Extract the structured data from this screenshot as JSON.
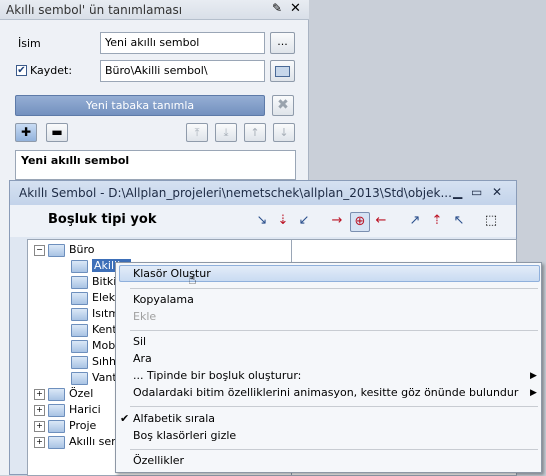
{
  "palette": {
    "title": "Akıllı sembol' ün tanımlaması",
    "pin_icon": "pin-icon",
    "close_icon": "close-icon",
    "name_label": "İsim",
    "name_value": "Yeni akıllı sembol",
    "browse_label": "...",
    "save_label": "Kaydet:",
    "save_checked": true,
    "path_value": "Büro\\Akilli sembol\\",
    "new_layer_button": "Yeni tabaka tanımla",
    "item_title": "Yeni akıllı sembol"
  },
  "window": {
    "title": "Akıllı Sembol - D:\\Allplan_projeleri\\nemetschek\\allplan_2013\\Std\\objek...",
    "toolbar_caption": "Boşluk tipi yok",
    "tree": {
      "root": "Büro",
      "children": [
        "Akilli s",
        "Bitkile",
        "Elektr",
        "Isıtma",
        "Kent",
        "Mobil",
        "Sıhhi",
        "Vantil"
      ],
      "others": [
        "Özel",
        "Harici",
        "Proje",
        "Akıllı semb"
      ]
    }
  },
  "context_menu": {
    "items": [
      {
        "label": "Klasör Oluştur",
        "enabled": true,
        "highlighted": true
      },
      {
        "label": "Kopyalama",
        "enabled": true
      },
      {
        "label": "Ekle",
        "enabled": false
      },
      {
        "label": "Sil",
        "enabled": true
      },
      {
        "label": "Ara",
        "enabled": true
      },
      {
        "label": "... Tipinde bir boşluk oluşturur:",
        "enabled": true,
        "submenu": true
      },
      {
        "label": "Odalardaki bitim özelliklerini animasyon, kesitte göz önünde bulundur",
        "enabled": true,
        "submenu": true
      },
      {
        "label": "Alfabetik sırala",
        "enabled": true,
        "checked": true
      },
      {
        "label": "Boş klasörleri gizle",
        "enabled": true
      },
      {
        "label": "Özellikler",
        "enabled": true
      }
    ]
  }
}
